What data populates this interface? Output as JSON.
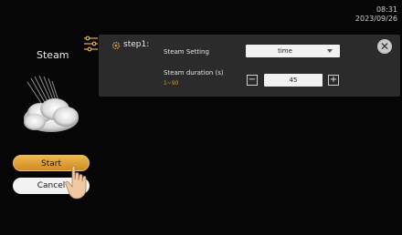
{
  "status": {
    "time": "08:31",
    "date": "2023/09/26"
  },
  "left": {
    "title": "Steam",
    "start_label": "Start",
    "cancel_label": "Cancel"
  },
  "panel": {
    "step_label": "step1:",
    "setting_label": "Steam Setting",
    "setting_value": "time",
    "duration_label": "Steam duration (s)",
    "duration_range": "1~90",
    "duration_value": "45",
    "minus_symbol": "−",
    "plus_symbol": "+",
    "close_symbol": "✕"
  },
  "colors": {
    "background": "#060606",
    "panel": "#2b2b2b",
    "accent": "#d19a3a",
    "start_button": "#e0a640"
  },
  "icons": [
    "settings-sliders-icon",
    "step-gear-icon",
    "steam-cloud-icon",
    "pointer-hand-icon",
    "close-icon",
    "chevron-down-icon"
  ]
}
